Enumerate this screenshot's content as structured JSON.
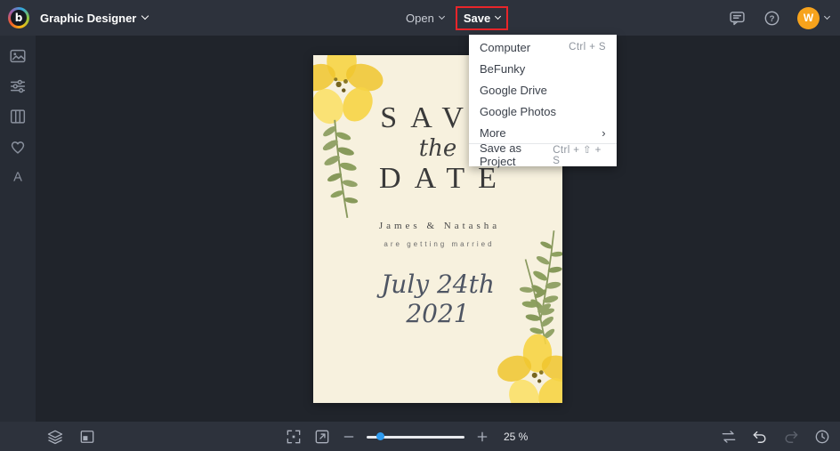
{
  "topbar": {
    "mode_label": "Graphic Designer",
    "open_label": "Open",
    "save_label": "Save",
    "avatar_initial": "W",
    "help_glyph": "?",
    "logo_glyph": "b"
  },
  "save_menu": {
    "items": [
      {
        "label": "Computer",
        "shortcut": "Ctrl + S"
      },
      {
        "label": "BeFunky",
        "shortcut": ""
      },
      {
        "label": "Google Drive",
        "shortcut": ""
      },
      {
        "label": "Google Photos",
        "shortcut": ""
      },
      {
        "label": "More",
        "shortcut": "›"
      },
      {
        "label": "Save as Project",
        "shortcut": "Ctrl + ⇧ + S"
      }
    ]
  },
  "canvas": {
    "design": {
      "title_top": "SAVE",
      "title_mid": "the",
      "title_bottom": "DATE",
      "names": "James & Natasha",
      "tagline": "are getting married",
      "date_line1": "July 24th",
      "date_line2": "2021"
    }
  },
  "bottombar": {
    "zoom_label": "25 %"
  },
  "colors": {
    "topbar_bg": "#2d323c",
    "sidebar_bg": "#272c35",
    "canvas_bg": "#20242b",
    "accent_blue": "#2e9bf0",
    "annotation_red": "#e8252a",
    "avatar_orange": "#f7a31c",
    "card_cream": "#f7f1de",
    "flower_yellow": "#f5d23e",
    "leaf_green": "#8da05f"
  },
  "icons": {
    "sidebar": [
      "image-icon",
      "adjust-icon",
      "layout-icon",
      "heart-icon",
      "text-icon"
    ],
    "topbar_right": [
      "comment-icon",
      "help-icon",
      "avatar"
    ],
    "bottombar_left": [
      "layers-icon",
      "artboard-icon"
    ],
    "bottombar_center": [
      "fit-screen-icon",
      "fullscreen-icon",
      "zoom-out-icon",
      "zoom-slider",
      "zoom-in-icon"
    ],
    "bottombar_right": [
      "compare-icon",
      "undo-icon",
      "redo-icon",
      "history-icon"
    ]
  }
}
